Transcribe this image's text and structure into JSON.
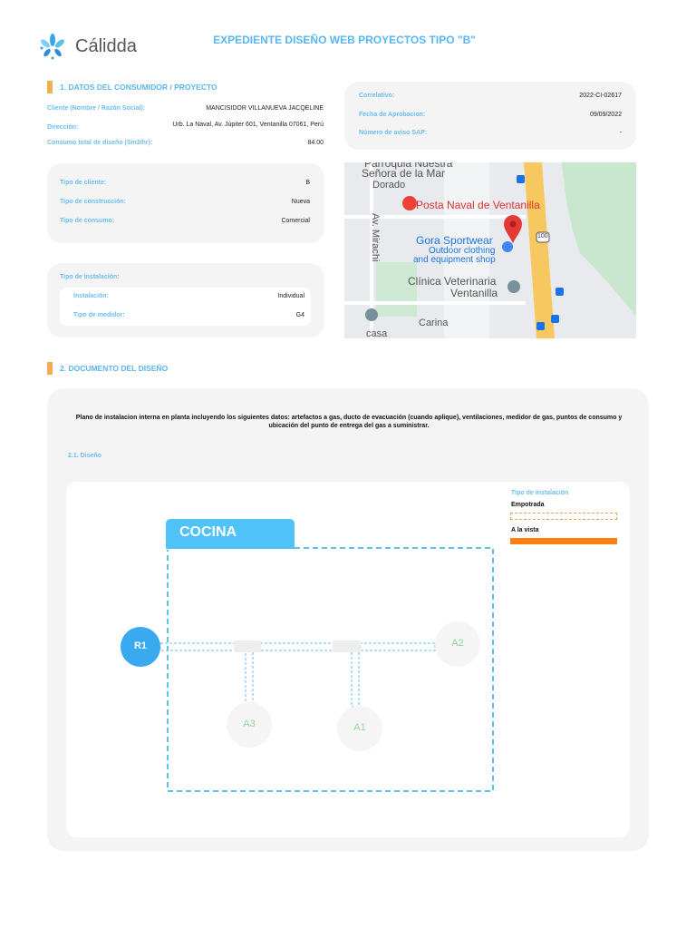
{
  "header": {
    "brand": "Cálidda",
    "title": "EXPEDIENTE DISEÑO WEB PROYECTOS TIPO \"B\""
  },
  "section1": {
    "title": "1. DATOS DEL CONSUMIDOR / PROYECTO",
    "cliente_label": "Cliente (Nombre / Razón Social):",
    "cliente": "MANCISIDOR VILLANUEVA JACQELINE",
    "direccion_label": "Dirección:",
    "direccion": "Urb. La Naval, Av. Júpiter 601, Ventanilla 07061, Perú",
    "consumo_label": "Consumo total de diseño (Sm3/hr):",
    "consumo": "84.00"
  },
  "meta": {
    "correlativo_label": "Correlativo:",
    "correlativo": "2022-CI-02617",
    "fecha_label": "Fecha de Aprobacion:",
    "fecha": "09/09/2022",
    "sap_label": "Número de aviso SAP:",
    "sap": "-"
  },
  "tipo": {
    "cliente_label": "Tipo de cliente:",
    "cliente": "B",
    "construccion_label": "Tipo de construcción:",
    "construccion": "Nueva",
    "consumo_label": "Tipo de consumo:",
    "consumo": "Comercial"
  },
  "instalacion": {
    "title": "Tipo de instalación:",
    "instalacion_label": "Instalación:",
    "instalacion": "Individual",
    "medidor_label": "Tipo de medidor:",
    "medidor": "G4"
  },
  "map": {
    "labels": [
      "Parroquia Nuestra",
      "Señora de la Mar",
      "Dorado",
      "Posta Naval de Ventanilla",
      "Av. Mirachi",
      "Gora Sportwear",
      "Outdoor clothing",
      "and equipment shop",
      "Clínica Veterinaria",
      "Ventanilla",
      "Carina",
      "casa",
      "100"
    ]
  },
  "section2": {
    "title": "2. DOCUMENTO DEL DISEÑO",
    "description": "Plano de instalacion interna en planta incluyendo los siguientes datos: artefactos a gas, ducto de evacuación (cuando aplique), ventilaciones, medidor de gas, puntos de consumo y ubicación del punto de entrega del gas a suministrar.",
    "subtitle": "2.1. Diseño"
  },
  "legend": {
    "title": "Tipo de instalación",
    "empotrada": "Empotrada",
    "vista": "A la vista",
    "colors": {
      "empotrada": "#f0a050",
      "vista": "#ff7f10"
    }
  },
  "plan": {
    "room": "COCINA",
    "regulator": "R1",
    "appliances": [
      "A1",
      "A2",
      "A3"
    ]
  }
}
